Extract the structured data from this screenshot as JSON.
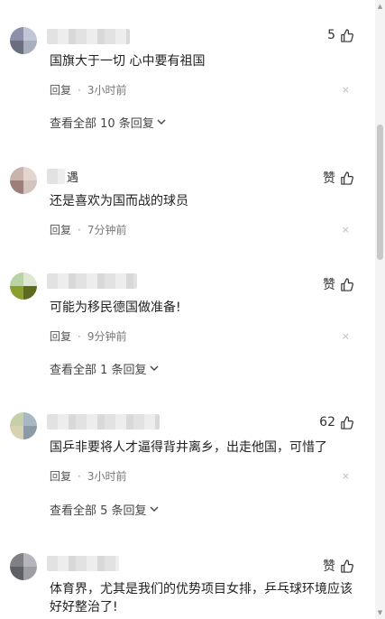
{
  "ui": {
    "reply_label": "回复",
    "dot": "·",
    "close_glyph": "×"
  },
  "comments": [
    {
      "name": "",
      "likes": "5",
      "text": "国旗大于一切 心中要有祖国",
      "time": "3小时前",
      "more": "查看全部 10 条回复"
    },
    {
      "name": "遇",
      "likes": "赞",
      "text": "还是喜欢为国而战的球员",
      "time": "7分钟前",
      "more": ""
    },
    {
      "name": "",
      "likes": "赞",
      "text": "可能为移民德国做准备!",
      "time": "9分钟前",
      "more": "查看全部 1 条回复"
    },
    {
      "name": "",
      "likes": "62",
      "text": "国乒非要将人才逼得背井离乡，出走他国，可惜了",
      "time": "3小时前",
      "more": "查看全部 5 条回复"
    },
    {
      "name": "",
      "likes": "赞",
      "text": "体育界，尤其是我们的优势项目女排，乒乓球环境应该好好整治了!",
      "time": "",
      "more": ""
    }
  ],
  "colors": {
    "text": "#222222",
    "muted": "#777777",
    "scroll_thumb": "#c8c8c8"
  }
}
